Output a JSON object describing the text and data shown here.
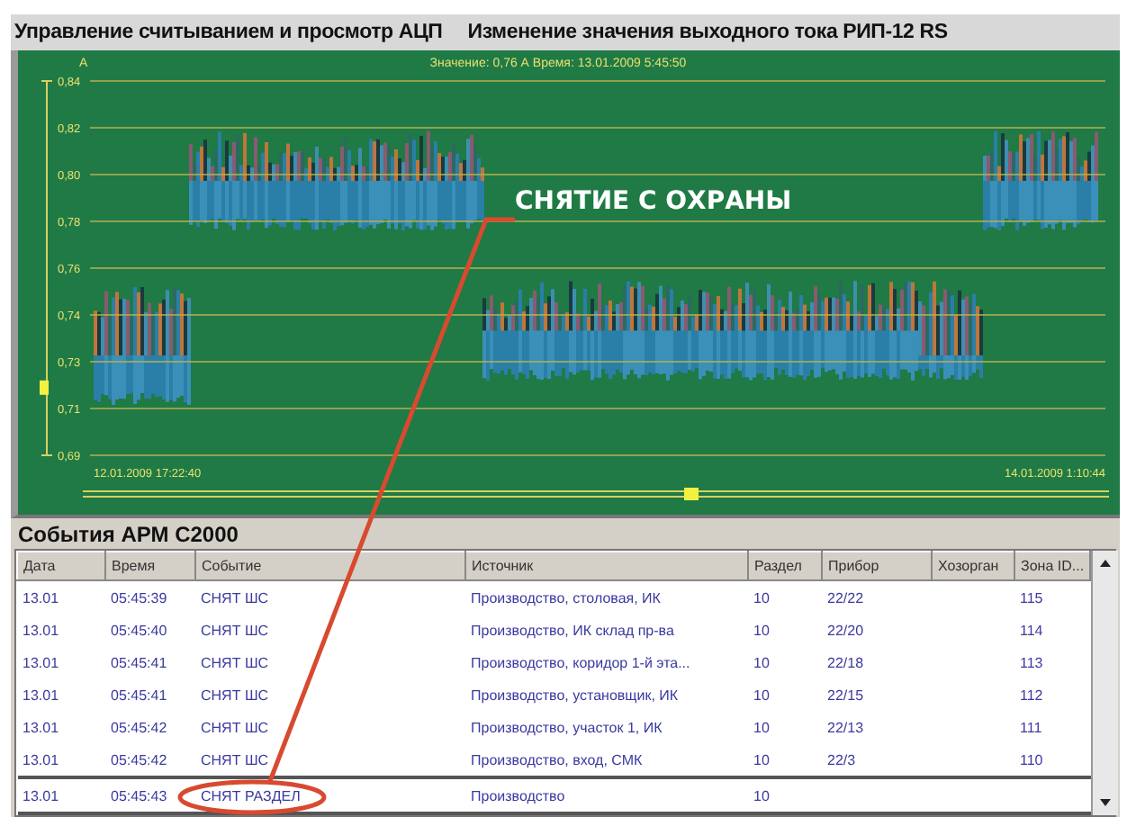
{
  "window": {
    "title": "Управление считыванием и просмотр АЦП",
    "subtitle": "Изменение значения выходного тока РИП-12 RS"
  },
  "chart": {
    "unit": "А",
    "readout": "Значение: 0,76 А Время: 13.01.2009 5:45:50",
    "y_labels": [
      "0,84",
      "0,82",
      "0,80",
      "0,78",
      "0,76",
      "0,74",
      "0,73",
      "0,71",
      "0,69"
    ],
    "start_label": "12.01.2009 17:22:40",
    "end_label": "14.01.2009 1:10:44"
  },
  "annotation": {
    "text": "СНЯТИЕ С ОХРАНЫ"
  },
  "events": {
    "title": "События АРМ С2000",
    "columns": [
      "Дата",
      "Время",
      "Событие",
      "Источник",
      "Раздел",
      "Прибор",
      "Хозорган",
      "Зона ID..."
    ],
    "rows": [
      {
        "cells": [
          "13.01",
          "05:45:39",
          "СНЯТ ШС",
          "Производство, столовая, ИК",
          "10",
          "22/22",
          "",
          "115"
        ],
        "selected": false
      },
      {
        "cells": [
          "13.01",
          "05:45:40",
          "СНЯТ ШС",
          "Производство, ИК склад пр-ва",
          "10",
          "22/20",
          "",
          "114"
        ],
        "selected": false
      },
      {
        "cells": [
          "13.01",
          "05:45:41",
          "СНЯТ ШС",
          "Производство, коридор 1-й эта...",
          "10",
          "22/18",
          "",
          "113"
        ],
        "selected": false
      },
      {
        "cells": [
          "13.01",
          "05:45:41",
          "СНЯТ ШС",
          "Производство, установщик, ИК",
          "10",
          "22/15",
          "",
          "112"
        ],
        "selected": false
      },
      {
        "cells": [
          "13.01",
          "05:45:42",
          "СНЯТ ШС",
          "Производство, участок 1, ИК",
          "10",
          "22/13",
          "",
          "111"
        ],
        "selected": false
      },
      {
        "cells": [
          "13.01",
          "05:45:42",
          "СНЯТ ШС",
          "Производство, вход, СМК",
          "10",
          "22/3",
          "",
          "110"
        ],
        "selected": false
      },
      {
        "cells": [
          "13.01",
          "05:45:43",
          "СНЯТ РАЗДЕЛ",
          "Производство",
          "10",
          "",
          "",
          ""
        ],
        "selected": true
      }
    ]
  }
}
